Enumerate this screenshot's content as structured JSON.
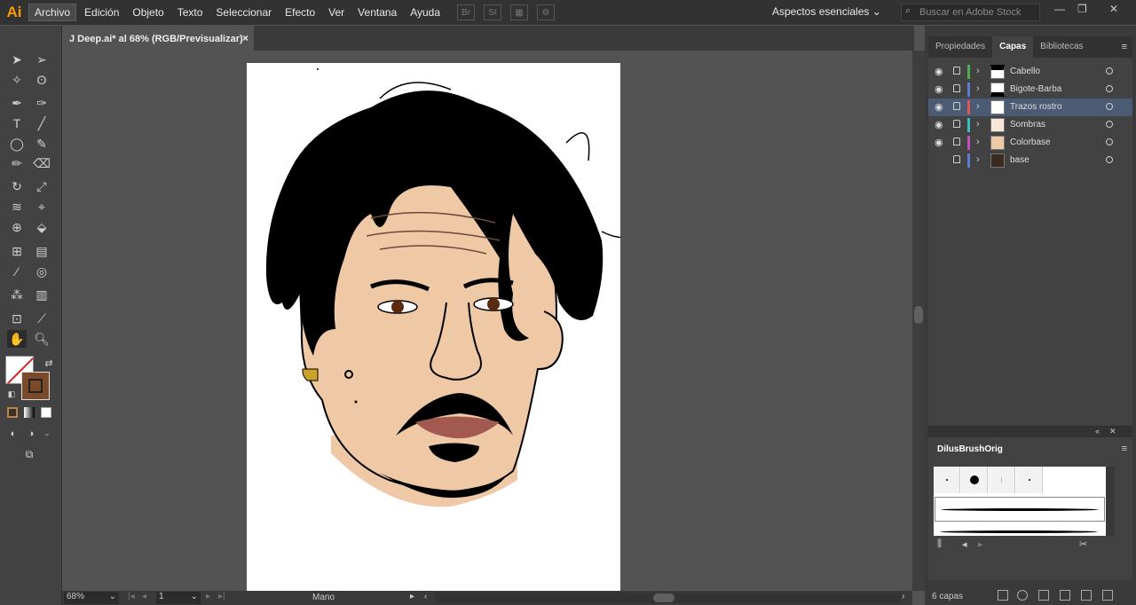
{
  "app": {
    "logo": "Ai",
    "workspace_label": "Aspectos esenciales",
    "search_placeholder": "Buscar en Adobe Stock"
  },
  "menu": {
    "items": [
      "Archivo",
      "Edición",
      "Objeto",
      "Texto",
      "Seleccionar",
      "Efecto",
      "Ver",
      "Ventana",
      "Ayuda"
    ],
    "bridge": "Br",
    "stock": "St"
  },
  "document": {
    "tab_title": "J Deep.ai* al 68% (RGB/Previsualizar)",
    "close": "×"
  },
  "status": {
    "zoom": "68%",
    "page": "1",
    "tool": "Mano"
  },
  "panel": {
    "tabs": [
      "Propiedades",
      "Capas",
      "Bibliotecas"
    ],
    "active_tab": "Capas",
    "layers": [
      {
        "name": "Cabello",
        "color": "#4caf50",
        "visible": true,
        "selected": false
      },
      {
        "name": "Bigote-Barba",
        "color": "#5b7bd6",
        "visible": true,
        "selected": false
      },
      {
        "name": "Trazos rostro",
        "color": "#e05555",
        "visible": true,
        "selected": true
      },
      {
        "name": "Sombras",
        "color": "#38c0c0",
        "visible": true,
        "selected": false
      },
      {
        "name": "Colorbase",
        "color": "#c050c0",
        "visible": true,
        "selected": false
      },
      {
        "name": "base",
        "color": "#5b7bd6",
        "visible": false,
        "selected": false
      }
    ],
    "layer_count": "6 capas"
  },
  "brushes": {
    "tab": "DilusBrushOrig"
  },
  "colors": {
    "skin": "#efc8a6",
    "hair": "#000000",
    "lips": "#a25a50",
    "earring": "#c9a227",
    "accent": "#ff9a00"
  }
}
